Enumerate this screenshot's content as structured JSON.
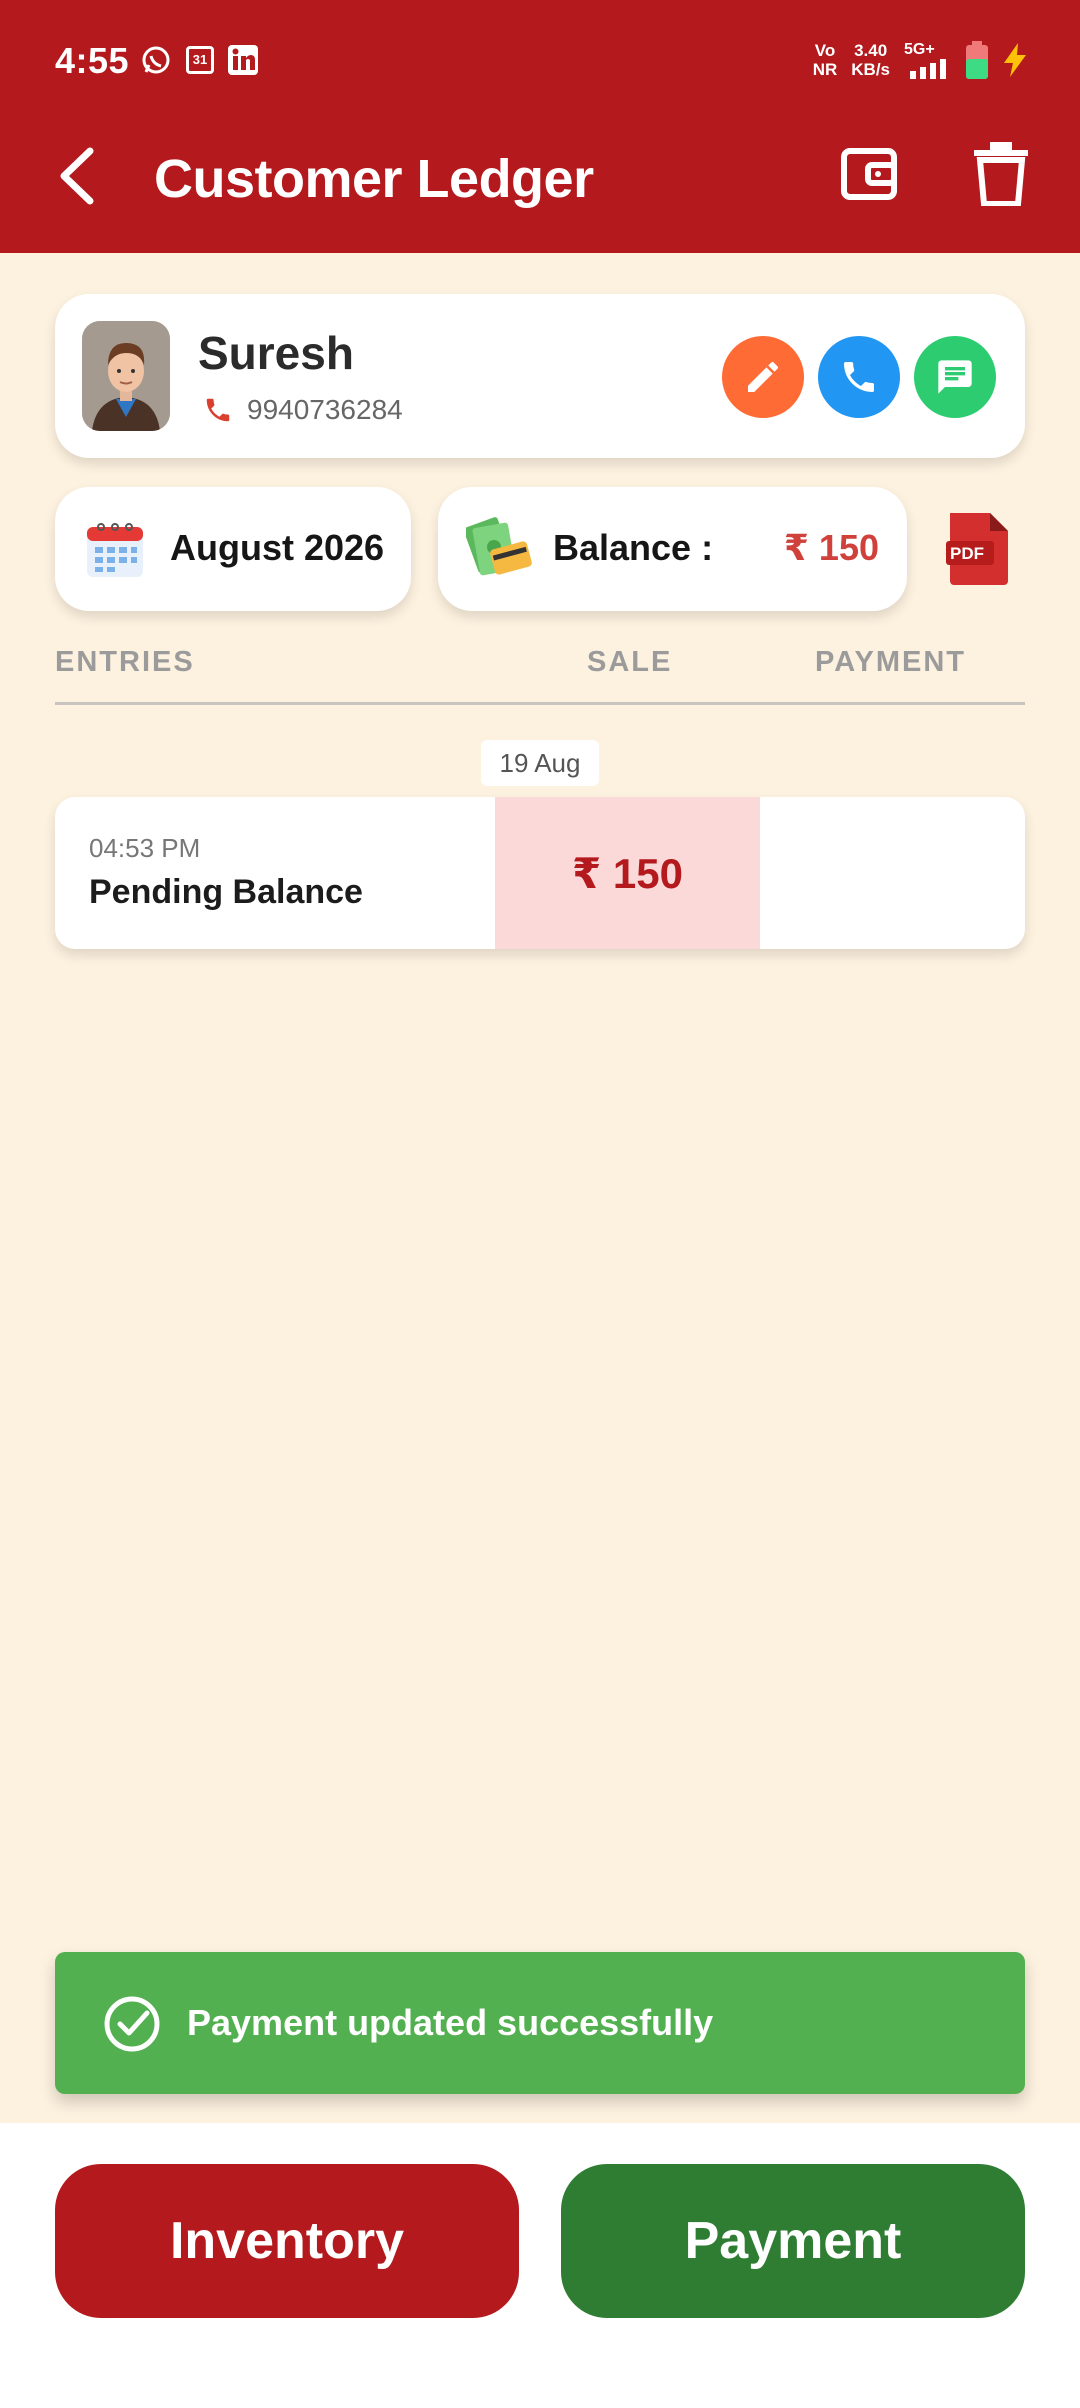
{
  "status_bar": {
    "time": "4:55",
    "volte_top": "Vo",
    "volte_bottom": "NR",
    "speed_value": "3.40",
    "speed_unit": "KB/s",
    "network": "5G+",
    "calendar_day": "31"
  },
  "app_bar": {
    "title": "Customer Ledger",
    "color": "#B3191D"
  },
  "customer": {
    "name": "Suresh",
    "phone": "9940736284",
    "action_colors": {
      "edit": "#FF6B35",
      "call": "#2196F3",
      "message": "#2ECC71"
    }
  },
  "filters": {
    "month_label": "August 2026",
    "balance_label": "Balance :",
    "balance_amount": "₹ 150",
    "pdf_label": "PDF"
  },
  "table": {
    "headers": {
      "entries": "ENTRIES",
      "sale": "SALE",
      "payment": "PAYMENT"
    },
    "groups": [
      {
        "date": "19 Aug",
        "entries": [
          {
            "time": "04:53 PM",
            "name": "Pending Balance",
            "sale": "₹ 150",
            "payment": ""
          }
        ]
      }
    ]
  },
  "toast": {
    "message": "Payment updated successfully",
    "color": "#52B050"
  },
  "bottom_actions": {
    "inventory_label": "Inventory",
    "payment_label": "Payment"
  }
}
